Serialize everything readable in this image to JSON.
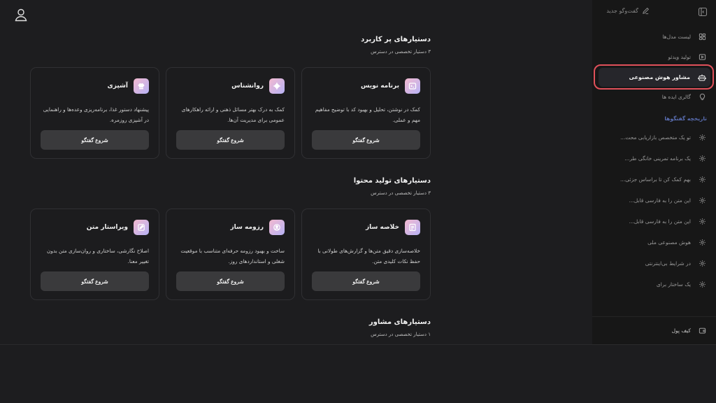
{
  "sidebar": {
    "new_chat": "گفت‌وگو جدید",
    "nav": [
      {
        "label": "لیست مدل‌ها",
        "icon": "grid-icon"
      },
      {
        "label": "تولید ویدئو",
        "icon": "video-icon"
      },
      {
        "label": "مشاور هوش مصنوعی",
        "icon": "robot-icon"
      },
      {
        "label": "گالری ایده ها",
        "icon": "lightbulb-icon"
      }
    ],
    "history_title": "تاریخچه گفتگوها",
    "history": [
      "تو یک متخصص بازاریابی محت...",
      "یک برنامه تمرینی خانگی طر...",
      "بهم کمک کن تا براساس جزئی...",
      "این متن را به فارسی قابل...",
      "این متن را به فارسی قابل...",
      "هوش مصنوعی ملی",
      "در شرایط بی‌اینترنتی",
      "یک ساختار برای"
    ],
    "wallet": "کیف پول"
  },
  "sections": [
    {
      "title": "دستیارهای پر کاربرد",
      "subtitle": "۳ دستیار تخصصی در دسترس",
      "cards": [
        {
          "title": "برنامه نویس",
          "icon": "code-icon",
          "desc": "کمک در نوشتن، تحلیل و بهبود کد با توضیح مفاهیم مهم و عملی.",
          "button": "شروع گفتگو"
        },
        {
          "title": "روانشناس",
          "icon": "brain-icon",
          "desc": "کمک به درک بهتر مسائل ذهنی و ارائه راهکارهای عمومی برای مدیریت آن‌ها.",
          "button": "شروع گفتگو"
        },
        {
          "title": "آشپزی",
          "icon": "chef-hat-icon",
          "desc": "پیشنهاد دستور غذا، برنامه‌ریزی وعده‌ها و راهنمایی در آشپزی روزمره.",
          "button": "شروع گفتگو"
        }
      ]
    },
    {
      "title": "دستیارهای تولید محتوا",
      "subtitle": "۳ دستیار تخصصی در دسترس",
      "cards": [
        {
          "title": "خلاصه ساز",
          "icon": "document-icon",
          "desc": "خلاصه‌سازی دقیق متن‌ها و گزارش‌های طولانی با حفظ نکات کلیدی متن.",
          "button": "شروع گفتگو"
        },
        {
          "title": "رزومه ساز",
          "icon": "resume-icon",
          "desc": "ساخت و بهبود رزومه حرفه‌ای متناسب با موقعیت شغلی و استانداردهای روز.",
          "button": "شروع گفتگو"
        },
        {
          "title": "ویراستار متن",
          "icon": "edit-icon",
          "desc": "اصلاح نگارشی، ساختاری و روان‌سازی متن بدون تغییر معنا.",
          "button": "شروع گفتگو"
        }
      ]
    },
    {
      "title": "دستیارهای مشاور",
      "subtitle": "۱ دستیار تخصصی در دسترس",
      "cards": []
    }
  ],
  "colors": {
    "background": "#1d1d1f",
    "sidebar": "#171717",
    "card_border": "#303033",
    "button": "#3a3a3c",
    "highlight": "#e0505a",
    "history_title": "#5b6fb5"
  }
}
